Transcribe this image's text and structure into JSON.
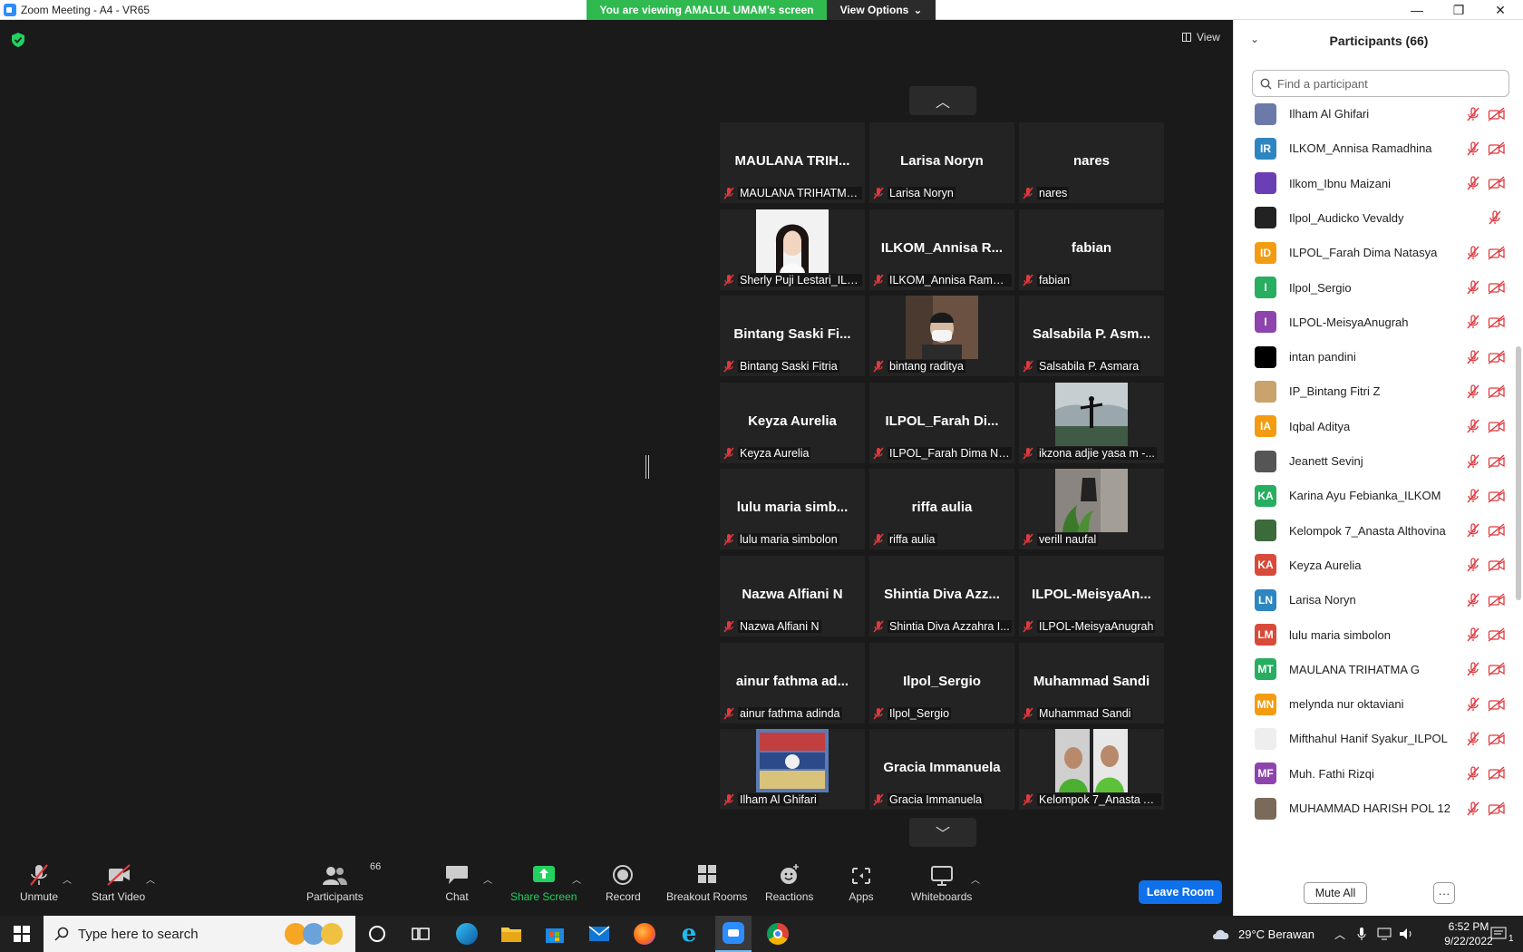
{
  "window": {
    "title": "Zoom Meeting - A4 - VR65",
    "minimize": "—",
    "maximize": "❐",
    "close": "✕"
  },
  "share_banner": {
    "text": "You are viewing AMALUL UMAM's screen",
    "view_options": "View Options"
  },
  "meeting": {
    "view_label": "View",
    "pager_up": "︿",
    "pager_down": "﹀"
  },
  "tiles": [
    {
      "big": "MAULANA TRIH...",
      "label": "MAULANA TRIHATMA..."
    },
    {
      "big": "Larisa Noryn",
      "label": "Larisa Noryn"
    },
    {
      "big": "nares",
      "label": "nares"
    },
    {
      "big": "",
      "label": "Sherly Puji Lestari_ILP...",
      "photo": "woman"
    },
    {
      "big": "ILKOM_Annisa R...",
      "label": "ILKOM_Annisa Ramad..."
    },
    {
      "big": "fabian",
      "label": "fabian"
    },
    {
      "big": "Bintang Saski Fi...",
      "label": "Bintang Saski Fitria"
    },
    {
      "big": "",
      "label": "bintang raditya",
      "photo": "man-mask"
    },
    {
      "big": "Salsabila P. Asm...",
      "label": "Salsabila P. Asmara"
    },
    {
      "big": "Keyza Aurelia",
      "label": "Keyza Aurelia"
    },
    {
      "big": "ILPOL_Farah Di...",
      "label": "ILPOL_Farah Dima Na..."
    },
    {
      "big": "",
      "label": "ikzona adjie yasa m -...",
      "photo": "outdoor"
    },
    {
      "big": "lulu maria simb...",
      "label": "lulu maria simbolon"
    },
    {
      "big": "riffa aulia",
      "label": "riffa aulia"
    },
    {
      "big": "",
      "label": "verill naufal",
      "photo": "plant"
    },
    {
      "big": "Nazwa Alfiani N",
      "label": "Nazwa Alfiani N"
    },
    {
      "big": "Shintia Diva Azz...",
      "label": "Shintia Diva Azzahra I..."
    },
    {
      "big": "ILPOL-MeisyaAn...",
      "label": "ILPOL-MeisyaAnugrah"
    },
    {
      "big": "ainur fathma ad...",
      "label": "ainur fathma adinda"
    },
    {
      "big": "Ilpol_Sergio",
      "label": "Ilpol_Sergio"
    },
    {
      "big": "Muhammad Sandi",
      "label": "Muhammad Sandi"
    },
    {
      "big": "",
      "label": "Ilham Al Ghifari",
      "photo": "poster"
    },
    {
      "big": "Gracia Immanuela",
      "label": "Gracia Immanuela"
    },
    {
      "big": "",
      "label": "Kelompok 7_Anasta A...",
      "photo": "green-duo"
    }
  ],
  "participants_panel": {
    "title": "Participants (66)",
    "search_placeholder": "Find a participant",
    "mute_all": "Mute All",
    "more": "···",
    "items": [
      {
        "initials": "",
        "name": "Ilham Al Ghifari",
        "color": "#6b7aa8",
        "photo": true,
        "video": true
      },
      {
        "initials": "IR",
        "name": "ILKOM_Annisa Ramadhina",
        "color": "#2e86c1",
        "video": true
      },
      {
        "initials": "",
        "name": "Ilkom_Ibnu Maizani",
        "color": "#6a3fb5",
        "photo": true,
        "video": true
      },
      {
        "initials": "",
        "name": "Ilpol_Audicko Vevaldy",
        "color": "#222222",
        "photo": true,
        "video": false
      },
      {
        "initials": "ID",
        "name": "ILPOL_Farah Dima Natasya",
        "color": "#f39c12",
        "video": true
      },
      {
        "initials": "I",
        "name": "Ilpol_Sergio",
        "color": "#27ae60",
        "video": true
      },
      {
        "initials": "I",
        "name": "ILPOL-MeisyaAnugrah",
        "color": "#8e44ad",
        "video": true
      },
      {
        "initials": "",
        "name": "intan pandini",
        "color": "#000000",
        "video": true
      },
      {
        "initials": "",
        "name": "IP_Bintang Fitri Z",
        "color": "#c9a36b",
        "photo": true,
        "video": true
      },
      {
        "initials": "IA",
        "name": "Iqbal Aditya",
        "color": "#f39c12",
        "video": true
      },
      {
        "initials": "",
        "name": "Jeanett Sevinj",
        "color": "#555555",
        "photo": true,
        "video": true
      },
      {
        "initials": "KA",
        "name": "Karina Ayu Febianka_ILKOM",
        "color": "#27ae60",
        "video": true
      },
      {
        "initials": "",
        "name": "Kelompok 7_Anasta Althovina",
        "color": "#3b6b3b",
        "photo": true,
        "video": true
      },
      {
        "initials": "KA",
        "name": "Keyza Aurelia",
        "color": "#d84a3a",
        "video": true
      },
      {
        "initials": "LN",
        "name": "Larisa Noryn",
        "color": "#2e86c1",
        "video": true
      },
      {
        "initials": "LM",
        "name": "lulu maria simbolon",
        "color": "#d84a3a",
        "video": true
      },
      {
        "initials": "MT",
        "name": "MAULANA TRIHATMA G",
        "color": "#27ae60",
        "video": true
      },
      {
        "initials": "MN",
        "name": "melynda nur oktaviani",
        "color": "#f39c12",
        "video": true
      },
      {
        "initials": "",
        "name": "Mifthahul Hanif Syakur_ILPOL",
        "color": "#eeeeee",
        "photo": true,
        "video": true
      },
      {
        "initials": "MF",
        "name": "Muh. Fathi Rizqi",
        "color": "#8e44ad",
        "video": true
      },
      {
        "initials": "",
        "name": "MUHAMMAD HARISH POL 12",
        "color": "#7a6a5a",
        "photo": true,
        "video": true
      }
    ]
  },
  "toolbar": {
    "unmute": "Unmute",
    "start_video": "Start Video",
    "participants": "Participants",
    "participants_count": "66",
    "chat": "Chat",
    "share_screen": "Share Screen",
    "record": "Record",
    "breakout_rooms": "Breakout Rooms",
    "reactions": "Reactions",
    "apps": "Apps",
    "whiteboards": "Whiteboards",
    "leave_room": "Leave Room"
  },
  "taskbar": {
    "search_placeholder": "Type here to search",
    "weather": "29°C  Berawan",
    "time": "6:52 PM",
    "date": "9/22/2022",
    "notifications": "1"
  },
  "colors": {
    "accent_blue": "#0e71eb",
    "banner_green": "#2fb94f",
    "muted_red": "#e0393e"
  }
}
